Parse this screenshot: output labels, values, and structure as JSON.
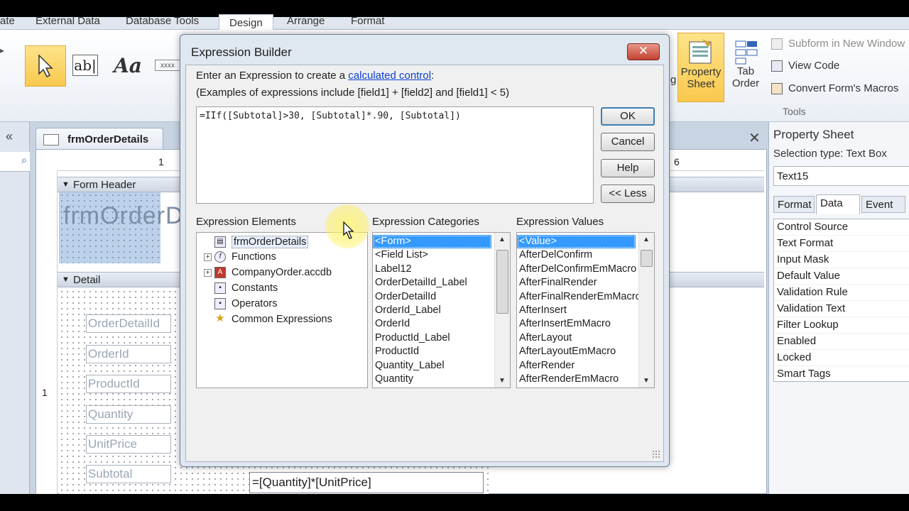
{
  "ribbon": {
    "tabs": [
      "ate",
      "External Data",
      "Database Tools",
      "Design",
      "Arrange",
      "Format"
    ],
    "property_sheet_label_1": "Property",
    "property_sheet_label_2": "Sheet",
    "tab_order_label_1": "Tab",
    "tab_order_label_2": "Order",
    "subform_label": "Subform in New Window",
    "view_code_label": "View Code",
    "convert_macros_label": "Convert Form's Macros",
    "tools_group_label": "Tools",
    "label_button": "ab|",
    "theme_button": "Aa",
    "placeholder_button": "xxxx",
    "g_fragment": "g"
  },
  "document": {
    "tab_title": "frmOrderDetails",
    "form_header_label": "Form Header",
    "detail_label": "Detail",
    "form_title_text": "frmOrderD",
    "ruler_mark_1": "1",
    "ruler_mark_6": "6",
    "vruler_mark": "1",
    "field_labels": [
      "OrderDetailId",
      "OrderId",
      "ProductId",
      "Quantity",
      "UnitPrice",
      "Subtotal"
    ],
    "calc_expression": "=[Quantity]*[UnitPrice]"
  },
  "property_sheet": {
    "title": "Property Sheet",
    "selection_type": "Selection type:  Text Box",
    "selected_control": "Text15",
    "tabs": [
      "Format",
      "Data",
      "Event"
    ],
    "active_tab": "Data",
    "rows": [
      "Control Source",
      "Text Format",
      "Input Mask",
      "Default Value",
      "Validation Rule",
      "Validation Text",
      "Filter Lookup",
      "Enabled",
      "Locked",
      "Smart Tags"
    ]
  },
  "dialog": {
    "title": "Expression Builder",
    "close_label": "✕",
    "prompt_prefix": "Enter an Expression to create a ",
    "prompt_link": "calculated control",
    "prompt_suffix": ":",
    "examples": "(Examples of expressions include [field1] + [field2] and [field1] < 5)",
    "expression": "=IIf([Subtotal]>30, [Subtotal]*.90, [Subtotal])",
    "buttons": {
      "ok": "OK",
      "cancel": "Cancel",
      "help": "Help",
      "less": "<< Less"
    },
    "elements_header": "Expression Elements",
    "categories_header": "Expression Categories",
    "values_header": "Expression Values",
    "elements": [
      {
        "label": "frmOrderDetails",
        "expand": "",
        "icon": "form-icon"
      },
      {
        "label": "Functions",
        "expand": "+",
        "icon": "function-icon"
      },
      {
        "label": "CompanyOrder.accdb",
        "expand": "+",
        "icon": "database-icon"
      },
      {
        "label": "Constants",
        "expand": "",
        "icon": "constants-icon"
      },
      {
        "label": "Operators",
        "expand": "",
        "icon": "operators-icon"
      },
      {
        "label": "Common Expressions",
        "expand": "",
        "icon": "star-icon"
      }
    ],
    "categories": [
      "<Form>",
      "<Field List>",
      "Label12",
      "OrderDetailId_Label",
      "OrderDetailId",
      "OrderId_Label",
      "OrderId",
      "ProductId_Label",
      "ProductId",
      "Quantity_Label",
      "Quantity"
    ],
    "values": [
      "<Value>",
      "AfterDelConfirm",
      "AfterDelConfirmEmMacro",
      "AfterFinalRender",
      "AfterFinalRenderEmMacro",
      "AfterInsert",
      "AfterInsertEmMacro",
      "AfterLayout",
      "AfterLayoutEmMacro",
      "AfterRender",
      "AfterRenderEmMacro"
    ]
  }
}
